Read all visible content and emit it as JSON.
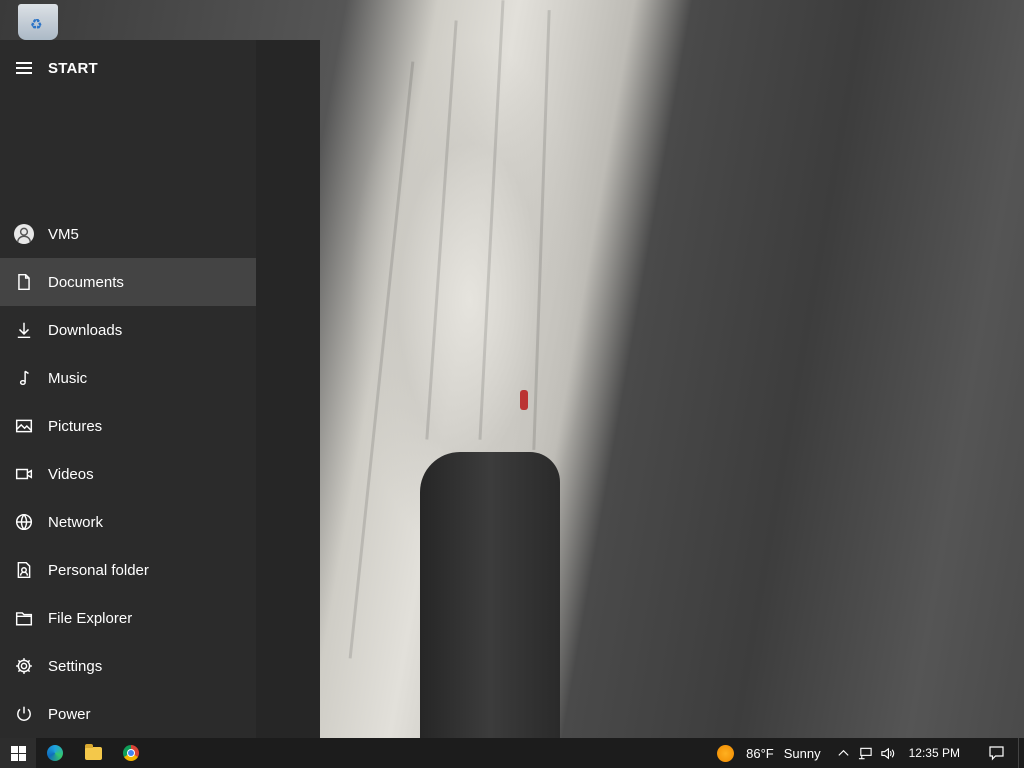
{
  "start_menu": {
    "title": "START",
    "items": [
      {
        "label": "VM5",
        "icon": "user-avatar-icon"
      },
      {
        "label": "Documents",
        "icon": "document-icon"
      },
      {
        "label": "Downloads",
        "icon": "download-icon"
      },
      {
        "label": "Music",
        "icon": "music-note-icon"
      },
      {
        "label": "Pictures",
        "icon": "picture-icon"
      },
      {
        "label": "Videos",
        "icon": "video-icon"
      },
      {
        "label": "Network",
        "icon": "globe-icon"
      },
      {
        "label": "Personal folder",
        "icon": "personal-folder-icon"
      },
      {
        "label": "File Explorer",
        "icon": "file-explorer-icon"
      },
      {
        "label": "Settings",
        "icon": "gear-icon"
      },
      {
        "label": "Power",
        "icon": "power-icon"
      }
    ],
    "active_item": "Documents"
  },
  "taskbar": {
    "weather": {
      "temperature": "86°F",
      "condition": "Sunny"
    },
    "clock": "12:35 PM",
    "pinned_apps": [
      "edge-browser-icon",
      "file-explorer-folder-icon",
      "chrome-browser-icon"
    ]
  },
  "colors": {
    "start_bg": "#2b2b2b",
    "active_item_bg": "#444444",
    "taskbar_bg": "#1c1c1c"
  }
}
